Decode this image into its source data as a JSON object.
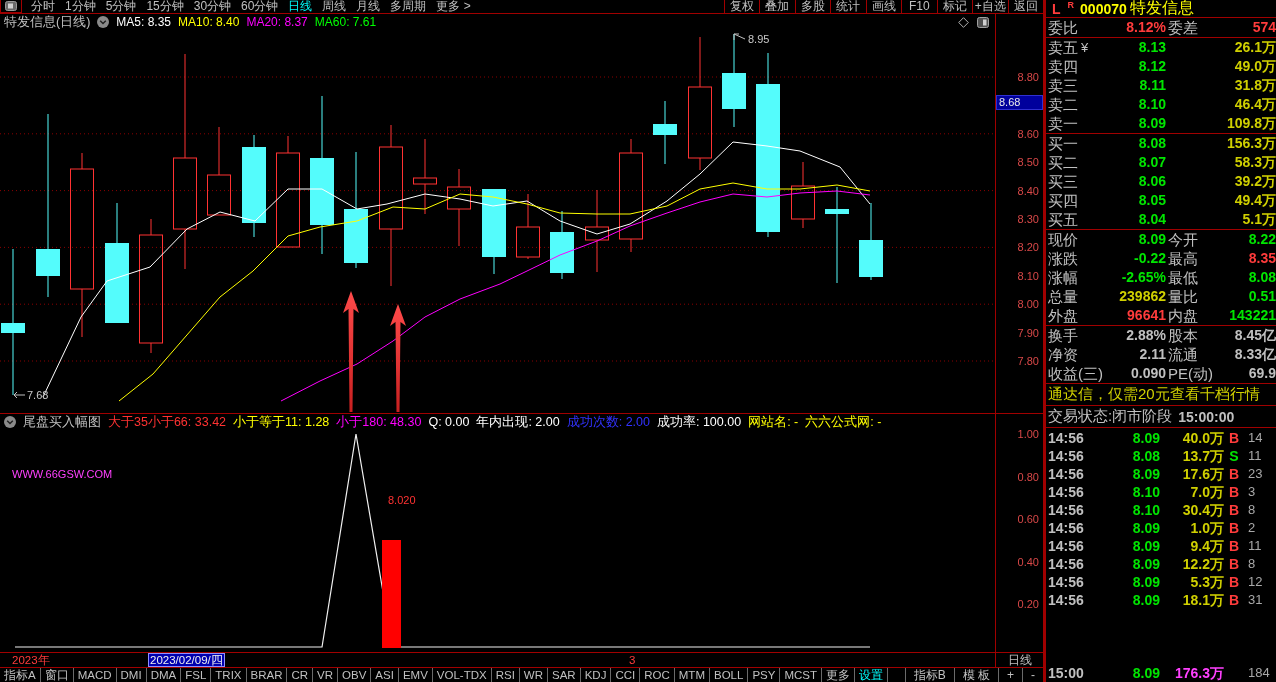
{
  "toolbar": {
    "periods": [
      {
        "label": "分时",
        "selected": false
      },
      {
        "label": "1分钟",
        "selected": false
      },
      {
        "label": "5分钟",
        "selected": false
      },
      {
        "label": "15分钟",
        "selected": false
      },
      {
        "label": "30分钟",
        "selected": false
      },
      {
        "label": "60分钟",
        "selected": false
      },
      {
        "label": "日线",
        "selected": true
      },
      {
        "label": "周线",
        "selected": false
      },
      {
        "label": "月线",
        "selected": false
      },
      {
        "label": "多周期",
        "selected": false
      },
      {
        "label": "更多 >",
        "selected": false
      }
    ],
    "buttons": [
      "复权",
      "叠加",
      "多股",
      "统计",
      "画线",
      "F10",
      "标记",
      "+自选",
      "返回"
    ]
  },
  "price_chart": {
    "title": "特发信息(日线)",
    "indicators": [
      {
        "label": "MA5: 8.35",
        "color": "#ffffff"
      },
      {
        "label": "MA10: 8.40",
        "color": "#ffff00"
      },
      {
        "label": "MA20: 8.37",
        "color": "#ff00ff"
      },
      {
        "label": "MA60: 7.61",
        "color": "#00ff00"
      }
    ],
    "axis_labels": [
      "8.80",
      "8.60",
      "8.50",
      "8.40",
      "8.30",
      "8.20",
      "8.10",
      "8.00",
      "7.90",
      "7.80"
    ],
    "price_tag": "8.68",
    "high_label": "8.95",
    "low_label": "7.68"
  },
  "indicator_chart": {
    "title": "尾盘买入幅图",
    "values": [
      {
        "label": "大于35小于66: 33.42",
        "color": "#ff3232"
      },
      {
        "label": "小于等于11: 1.28",
        "color": "#ffff00"
      },
      {
        "label": "小于180: 48.30",
        "color": "#ff00ff"
      },
      {
        "label": "Q: 0.00",
        "color": "#ffffff"
      },
      {
        "label": "年内出现: 2.00",
        "color": "#ffffff"
      },
      {
        "label": "成功次数: 2.00",
        "color": "#3232ff"
      },
      {
        "label": "成功率: 100.00",
        "color": "#ffffff"
      },
      {
        "label": "网站名: -",
        "color": "#ffff00"
      },
      {
        "label": "六六公式网: -",
        "color": "#ffff00"
      }
    ],
    "axis_labels": [
      "1.00",
      "0.80",
      "0.60",
      "0.40",
      "0.20"
    ],
    "site_text": "WWW.66GSW.COM",
    "bar_label": "8.020"
  },
  "date_bar": {
    "year": "2023年",
    "cursor_date": "2023/02/09/四",
    "month_mark": "3",
    "period": "日线"
  },
  "indicator_tabs": {
    "label_a": "指标A",
    "tabs": [
      {
        "label": "窗口",
        "kind": "tab"
      },
      {
        "label": "MACD",
        "kind": "tab"
      },
      {
        "label": "DMI",
        "kind": "tab"
      },
      {
        "label": "DMA",
        "kind": "tab"
      },
      {
        "label": "FSL",
        "kind": "tab"
      },
      {
        "label": "TRIX",
        "kind": "tab"
      },
      {
        "label": "BRAR",
        "kind": "tab"
      },
      {
        "label": "CR",
        "kind": "tab"
      },
      {
        "label": "VR",
        "kind": "tab"
      },
      {
        "label": "OBV",
        "kind": "tab"
      },
      {
        "label": "ASI",
        "kind": "tab"
      },
      {
        "label": "EMV",
        "kind": "tab"
      },
      {
        "label": "VOL-TDX",
        "kind": "tab"
      },
      {
        "label": "RSI",
        "kind": "tab"
      },
      {
        "label": "WR",
        "kind": "tab"
      },
      {
        "label": "SAR",
        "kind": "tab"
      },
      {
        "label": "KDJ",
        "kind": "tab"
      },
      {
        "label": "CCI",
        "kind": "tab"
      },
      {
        "label": "ROC",
        "kind": "tab"
      },
      {
        "label": "MTM",
        "kind": "tab"
      },
      {
        "label": "BOLL",
        "kind": "tab"
      },
      {
        "label": "PSY",
        "kind": "tab"
      },
      {
        "label": "MCST",
        "kind": "tab"
      },
      {
        "label": "更多",
        "kind": "tab"
      },
      {
        "label": "设置",
        "kind": "settings"
      }
    ],
    "label_b": "指标B",
    "template": "模 板",
    "buttons": [
      "+",
      "-"
    ]
  },
  "quote": {
    "market_flags": [
      "L",
      "R"
    ],
    "code": "000070",
    "name": "特发信息",
    "ratio_row": {
      "left": {
        "label": "委比",
        "value": "8.12%",
        "color": "#ff3c3c"
      },
      "right": {
        "label": "委差",
        "value": "574",
        "color": "#ff3c3c"
      }
    },
    "asks": [
      {
        "label": "卖五",
        "mark": "¥",
        "price": "8.13",
        "volume": "26.1万"
      },
      {
        "label": "卖四",
        "price": "8.12",
        "volume": "49.0万"
      },
      {
        "label": "卖三",
        "price": "8.11",
        "volume": "31.8万"
      },
      {
        "label": "卖二",
        "price": "8.10",
        "volume": "46.4万"
      },
      {
        "label": "卖一",
        "price": "8.09",
        "volume": "109.8万"
      }
    ],
    "bids": [
      {
        "label": "买一",
        "price": "8.08",
        "volume": "156.3万"
      },
      {
        "label": "买二",
        "price": "8.07",
        "volume": "58.3万"
      },
      {
        "label": "买三",
        "price": "8.06",
        "volume": "39.2万"
      },
      {
        "label": "买四",
        "price": "8.05",
        "volume": "49.4万"
      },
      {
        "label": "买五",
        "price": "8.04",
        "volume": "5.1万"
      }
    ],
    "stats": [
      {
        "left": {
          "label": "现价",
          "value": "8.09",
          "color": "#00e600"
        },
        "right": {
          "label": "今开",
          "value": "8.22",
          "color": "#00e600"
        }
      },
      {
        "left": {
          "label": "涨跌",
          "value": "-0.22",
          "color": "#00e600"
        },
        "right": {
          "label": "最高",
          "value": "8.35",
          "color": "#ff3c3c"
        }
      },
      {
        "left": {
          "label": "涨幅",
          "value": "-2.65%",
          "color": "#00e600"
        },
        "right": {
          "label": "最低",
          "value": "8.08",
          "color": "#00e600"
        }
      },
      {
        "left": {
          "label": "总量",
          "value": "239862",
          "color": "#d0d000"
        },
        "right": {
          "label": "量比",
          "value": "0.51",
          "color": "#00e600"
        }
      },
      {
        "left": {
          "label": "外盘",
          "value": "96641",
          "color": "#ff3c3c"
        },
        "right": {
          "label": "内盘",
          "value": "143221",
          "color": "#00e600"
        }
      }
    ],
    "fundamentals": [
      {
        "left": {
          "label": "换手",
          "value": "2.88%"
        },
        "right": {
          "label": "股本",
          "value": "8.45亿"
        }
      },
      {
        "left": {
          "label": "净资",
          "value": "2.11"
        },
        "right": {
          "label": "流通",
          "value": "8.33亿"
        }
      },
      {
        "left": {
          "label": "收益(三)",
          "value": "0.090"
        },
        "right": {
          "label": "PE(动)",
          "value": "69.9"
        }
      }
    ],
    "notice": "通达信，仅需20元查看千档行情",
    "trade_status": {
      "label": "交易状态:闭市阶段",
      "time": "15:00:00"
    },
    "trades": [
      {
        "time": "14:56",
        "price": "8.09",
        "volume": "40.0万",
        "big": false,
        "side": "B",
        "kind": "buy",
        "count": "14"
      },
      {
        "time": "14:56",
        "price": "8.08",
        "volume": "13.7万",
        "big": false,
        "side": "S",
        "kind": "sell",
        "count": "11"
      },
      {
        "time": "14:56",
        "price": "8.09",
        "volume": "17.6万",
        "big": false,
        "side": "B",
        "kind": "buy",
        "count": "23"
      },
      {
        "time": "14:56",
        "price": "8.10",
        "volume": "7.0万",
        "big": false,
        "side": "B",
        "kind": "buy",
        "count": "3"
      },
      {
        "time": "14:56",
        "price": "8.10",
        "volume": "30.4万",
        "big": false,
        "side": "B",
        "kind": "buy",
        "count": "8"
      },
      {
        "time": "14:56",
        "price": "8.09",
        "volume": "1.0万",
        "big": false,
        "side": "B",
        "kind": "buy",
        "count": "2"
      },
      {
        "time": "14:56",
        "price": "8.09",
        "volume": "9.4万",
        "big": false,
        "side": "B",
        "kind": "buy",
        "count": "11"
      },
      {
        "time": "14:56",
        "price": "8.09",
        "volume": "12.2万",
        "big": false,
        "side": "B",
        "kind": "buy",
        "count": "8"
      },
      {
        "time": "14:56",
        "price": "8.09",
        "volume": "5.3万",
        "big": false,
        "side": "B",
        "kind": "buy",
        "count": "12"
      },
      {
        "time": "14:56",
        "price": "8.09",
        "volume": "18.1万",
        "big": false,
        "side": "B",
        "kind": "buy",
        "count": "31"
      },
      {
        "time": "15:00",
        "price": "8.09",
        "volume": "176.3万",
        "big": true,
        "count": "184"
      }
    ]
  }
}
